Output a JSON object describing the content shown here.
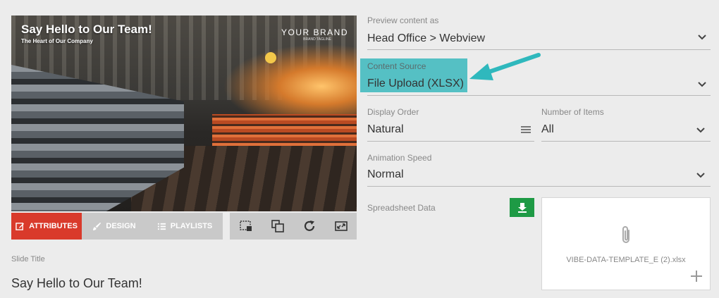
{
  "preview": {
    "title": "Say Hello to Our Team!",
    "subtitle": "The Heart of Our Company",
    "brand": "YOUR BRAND",
    "brand_sub": "BRAND TAGLINE"
  },
  "tabs": [
    {
      "label": "ATTRIBUTES",
      "icon": "edit-icon",
      "active": true
    },
    {
      "label": "DESIGN",
      "icon": "brush-icon",
      "active": false
    },
    {
      "label": "PLAYLISTS",
      "icon": "list-icon",
      "active": false
    }
  ],
  "tools": [
    "crop-frame-icon",
    "layers-icon",
    "refresh-icon",
    "fullscreen-icon"
  ],
  "slide_title": {
    "label": "Slide Title",
    "value": "Say Hello to Our Team!"
  },
  "form": {
    "preview_as": {
      "label": "Preview content as",
      "value": "Head Office > Webview"
    },
    "content_source": {
      "label": "Content Source",
      "value": "File Upload (XLSX)"
    },
    "display_order": {
      "label": "Display Order",
      "value": "Natural"
    },
    "number_of_items": {
      "label": "Number of Items",
      "value": "All"
    },
    "animation_speed": {
      "label": "Animation Speed",
      "value": "Normal"
    },
    "spreadsheet": {
      "label": "Spreadsheet Data",
      "file_name": "VIBE-DATA-TEMPLATE_E (2).xlsx"
    }
  },
  "colors": {
    "accent_red": "#d93a2b",
    "highlight_teal": "#55c0c4",
    "download_green": "#1e9a45",
    "arrow_teal": "#2fb8bd"
  }
}
